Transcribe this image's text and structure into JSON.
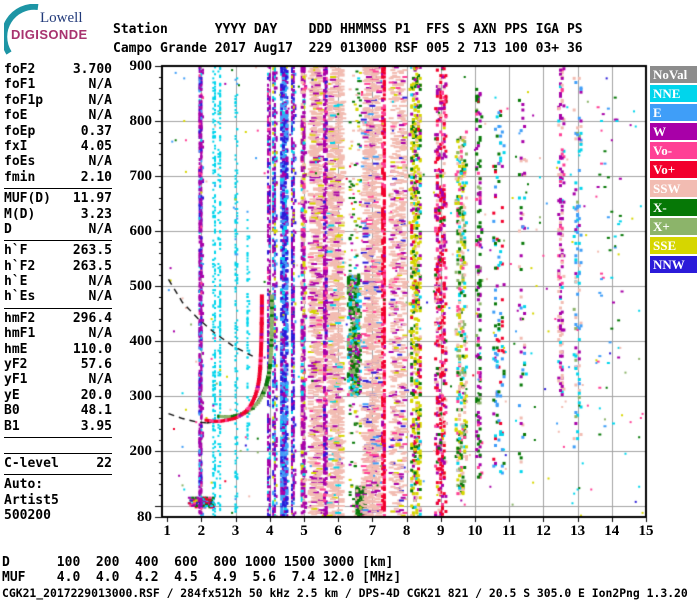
{
  "logo": {
    "line1": "Lowell",
    "line2": "DIGISONDE",
    "arc_color": "#1d95a5"
  },
  "header": {
    "line1": "Station      YYYY DAY    DDD HHMMSS P1  FFS S AXN PPS IGA PS",
    "line2": "Campo Grande 2017 Aug17  229 013000 RSF 005 2 713 100 03+ 36"
  },
  "params": [
    {
      "l": "foF2",
      "v": "3.700"
    },
    {
      "l": "foF1",
      "v": "N/A"
    },
    {
      "l": "foF1p",
      "v": "N/A"
    },
    {
      "l": "foE",
      "v": "N/A"
    },
    {
      "l": "foEp",
      "v": "0.37"
    },
    {
      "l": "fxI",
      "v": "4.05"
    },
    {
      "l": "foEs",
      "v": "N/A"
    },
    {
      "l": "fmin",
      "v": "2.10"
    },
    {
      "t": "sep"
    },
    {
      "l": "MUF(D)",
      "v": "11.97"
    },
    {
      "l": "M(D)",
      "v": "3.23"
    },
    {
      "l": "D",
      "v": "N/A"
    },
    {
      "t": "sep"
    },
    {
      "l": "h`F",
      "v": "263.5"
    },
    {
      "l": "h`F2",
      "v": "263.5"
    },
    {
      "l": "h`E",
      "v": "N/A"
    },
    {
      "l": "h`Es",
      "v": "N/A"
    },
    {
      "t": "sep"
    },
    {
      "l": "hmF2",
      "v": "296.4"
    },
    {
      "l": "hmF1",
      "v": "N/A"
    },
    {
      "l": "hmE",
      "v": "110.0"
    },
    {
      "l": "yF2",
      "v": "57.6"
    },
    {
      "l": "yF1",
      "v": "N/A"
    },
    {
      "l": "yE",
      "v": "20.0"
    },
    {
      "l": "B0",
      "v": "48.1"
    },
    {
      "l": "B1",
      "v": "3.95"
    },
    {
      "t": "sep"
    },
    {
      "t": "gap"
    },
    {
      "t": "sep"
    },
    {
      "l": "C-level",
      "v": "22"
    },
    {
      "t": "sep"
    },
    {
      "l": "Auto:",
      "v": ""
    },
    {
      "l": "Artist5",
      "v": ""
    },
    {
      "l": "500200",
      "v": ""
    }
  ],
  "legend": [
    {
      "label": "NoVal",
      "color": "#8c8c8c"
    },
    {
      "label": "NNE",
      "color": "#00d5ec"
    },
    {
      "label": "E",
      "color": "#3f9ef8"
    },
    {
      "label": "W",
      "color": "#a800a8"
    },
    {
      "label": "Vo-",
      "color": "#ff4095"
    },
    {
      "label": "Vo+",
      "color": "#f2002d"
    },
    {
      "label": "SSW",
      "color": "#f2bcb2"
    },
    {
      "label": "X-",
      "color": "#067806"
    },
    {
      "label": "X+",
      "color": "#8cb46a"
    },
    {
      "label": "SSE",
      "color": "#d6d600"
    },
    {
      "label": "NNW",
      "color": "#2b1bd9"
    }
  ],
  "footer": {
    "d_row": "D      100  200  400  600  800 1000 1500 3000 [km]",
    "muf_row": "MUF    4.0  4.0  4.2  4.5  4.9  5.6  7.4 12.0 [MHz]",
    "status": "CGK21_2017229013000.RSF / 284fx512h 50 kHz 2.5 km / DPS-4D CGK21 821 / 20.5 S 305.0 E Ion2Png 1.3.20"
  },
  "chart_data": {
    "type": "scatter",
    "title": "Digisonde RSF ionogram, Campo Grande, 2017 day 229 01:30:00",
    "xlabel": "[MHz]",
    "ylabel": "[km]",
    "xlim": [
      0.85,
      15.0
    ],
    "ylim": [
      80,
      900
    ],
    "grid": {
      "x_step": 1,
      "y_step": 100,
      "color": "#a2a2a2"
    },
    "x_ticks": [
      1,
      2,
      3,
      4,
      5,
      6,
      7,
      8,
      9,
      10,
      11,
      12,
      13,
      14,
      15
    ],
    "y_tick_labels": [
      900,
      800,
      700,
      600,
      500,
      400,
      300,
      200,
      80
    ],
    "legend_position": "right-outside",
    "palette": {
      "NoVal": "#8c8c8c",
      "NNE": "#00d5ec",
      "E": "#3f9ef8",
      "W": "#a800a8",
      "Vo-": "#ff4095",
      "Vo+": "#f2002d",
      "SSW": "#f2bcb2",
      "X-": "#067806",
      "X+": "#8cb46a",
      "SSE": "#d6d600",
      "NNW": "#2b1bd9"
    },
    "o_trace": {
      "name": "F-layer O-mode echo (foF2 3.70 MHz)",
      "dw": 4,
      "dh": 3,
      "colors": {
        "Vo+": 7,
        "Vo-": 2,
        "W": 1
      },
      "pts": [
        [
          2.15,
          256
        ],
        [
          2.35,
          254
        ],
        [
          2.55,
          254
        ],
        [
          2.75,
          256
        ],
        [
          2.95,
          259
        ],
        [
          3.1,
          263
        ],
        [
          3.25,
          269
        ],
        [
          3.38,
          277
        ],
        [
          3.48,
          287
        ],
        [
          3.57,
          299
        ],
        [
          3.64,
          313
        ],
        [
          3.69,
          330
        ],
        [
          3.72,
          350
        ],
        [
          3.74,
          374
        ],
        [
          3.755,
          402
        ],
        [
          3.765,
          432
        ],
        [
          3.77,
          460
        ],
        [
          3.77,
          482
        ]
      ]
    },
    "x_trace": {
      "name": "F-layer X-mode echo (fxI 4.05 MHz)",
      "dw": 4,
      "dh": 3,
      "colors": {
        "X+": 3,
        "X-": 2
      },
      "pts": [
        [
          2.52,
          263
        ],
        [
          2.72,
          262
        ],
        [
          2.92,
          263
        ],
        [
          3.12,
          266
        ],
        [
          3.32,
          271
        ],
        [
          3.5,
          278
        ],
        [
          3.66,
          288
        ],
        [
          3.79,
          301
        ],
        [
          3.89,
          316
        ],
        [
          3.96,
          334
        ],
        [
          4.01,
          356
        ],
        [
          4.04,
          382
        ],
        [
          4.055,
          412
        ],
        [
          4.06,
          442
        ],
        [
          4.06,
          470
        ],
        [
          4.06,
          482
        ]
      ]
    },
    "curves": [
      {
        "style": "dashed",
        "pts": [
          [
            1.04,
            512
          ],
          [
            1.45,
            470
          ],
          [
            1.9,
            441
          ],
          [
            2.4,
            414
          ],
          [
            2.9,
            392
          ],
          [
            3.35,
            377
          ],
          [
            3.62,
            369
          ]
        ]
      },
      {
        "style": "dashed",
        "pts": [
          [
            1.04,
            268
          ],
          [
            1.45,
            259
          ],
          [
            1.85,
            253
          ],
          [
            2.15,
            251
          ]
        ]
      },
      {
        "style": "solid",
        "pts": [
          [
            2.15,
            251
          ],
          [
            2.6,
            255
          ],
          [
            3.0,
            261
          ],
          [
            3.3,
            269
          ],
          [
            3.55,
            282
          ],
          [
            3.72,
            299
          ],
          [
            3.85,
            317
          ],
          [
            3.93,
            338
          ]
        ]
      },
      {
        "style": "solid",
        "pts": [
          [
            3.52,
            295
          ],
          [
            3.63,
            315
          ],
          [
            3.7,
            340
          ],
          [
            3.73,
            370
          ],
          [
            3.75,
            410
          ],
          [
            3.76,
            450
          ],
          [
            3.76,
            482
          ]
        ]
      }
    ],
    "noise_bands": [
      {
        "f": 2.0,
        "fw": 0.7,
        "h1": 97,
        "h2": 116,
        "n": 150,
        "dw": 3,
        "dh": 2,
        "c": {
          "Vo+": 2,
          "X-": 2,
          "E": 1,
          "W": 1.5,
          "NNE": 1,
          "SSE": 0.6,
          "NNW": 0.6,
          "Vo-": 0.8
        }
      },
      {
        "f": 1.98,
        "fw": 0.1,
        "h1": 80,
        "h2": 900,
        "n": 620,
        "dw": 2,
        "dh": 3,
        "c": {
          "W": 5,
          "NNW": 1,
          "E": 0.8,
          "Vo-": 0.5,
          "NNE": 0.4
        }
      },
      {
        "f": 2.38,
        "fw": 0.07,
        "h1": 80,
        "h2": 900,
        "n": 240,
        "dw": 2,
        "dh": 2,
        "c": {
          "NNE": 1
        }
      },
      {
        "f": 2.54,
        "fw": 0.05,
        "h1": 80,
        "h2": 900,
        "n": 190,
        "dw": 2,
        "dh": 2,
        "c": {
          "NNE": 1
        }
      },
      {
        "f": 3.02,
        "fw": 0.05,
        "h1": 80,
        "h2": 880,
        "n": 170,
        "dw": 2,
        "dh": 2,
        "c": {
          "NNE": 1,
          "E": 0.08
        }
      },
      {
        "f": 3.36,
        "fw": 0.05,
        "h1": 200,
        "h2": 620,
        "n": 80,
        "dw": 2,
        "dh": 2,
        "c": {
          "NNE": 1
        }
      },
      {
        "f": 3.97,
        "fw": 0.09,
        "h1": 80,
        "h2": 900,
        "n": 330,
        "dw": 2,
        "dh": 3,
        "c": {
          "W": 3,
          "NNW": 1,
          "NNE": 0.4,
          "Vo-": 0.4
        }
      },
      {
        "f": 4.14,
        "fw": 0.1,
        "h1": 80,
        "h2": 900,
        "n": 420,
        "dw": 2,
        "dh": 3,
        "c": {
          "W": 3,
          "NNE": 1,
          "NNW": 1,
          "SSE": 0.4,
          "E": 0.6
        }
      },
      {
        "f": 4.42,
        "fw": 0.18,
        "h1": 80,
        "h2": 900,
        "n": 1000,
        "dw": 3,
        "dh": 3,
        "c": {
          "E": 4,
          "NNW": 3,
          "W": 2,
          "NNE": 0.7
        }
      },
      {
        "f": 4.68,
        "fw": 0.1,
        "h1": 80,
        "h2": 900,
        "n": 480,
        "dw": 2,
        "dh": 3,
        "c": {
          "W": 3,
          "NNW": 2,
          "E": 1,
          "NNE": 0.4,
          "SSE": 0.3
        }
      },
      {
        "f": 4.98,
        "fw": 0.1,
        "h1": 80,
        "h2": 900,
        "n": 430,
        "dw": 3,
        "dh": 3,
        "c": {
          "W": 3,
          "SSW": 1,
          "NNE": 0.4,
          "SSE": 0.5,
          "Vo-": 0.5
        }
      },
      {
        "f": 5.38,
        "fw": 0.35,
        "h1": 80,
        "h2": 900,
        "n": 820,
        "dw": 6,
        "dh": 2,
        "c": {
          "SSW": 6,
          "W": 1,
          "Vo-": 0.3,
          "SSE": 0.3
        }
      },
      {
        "f": 5.63,
        "fw": 0.06,
        "h1": 80,
        "h2": 900,
        "n": 380,
        "dw": 3,
        "dh": 3,
        "c": {
          "W": 4,
          "Vo-": 1,
          "NNW": 0.5
        }
      },
      {
        "f": 5.93,
        "fw": 0.4,
        "h1": 80,
        "h2": 900,
        "n": 950,
        "dw": 6,
        "dh": 2,
        "c": {
          "SSW": 8,
          "W": 0.5,
          "SSE": 0.5,
          "NNE": 0.3
        }
      },
      {
        "f": 6.47,
        "fw": 0.35,
        "h1": 300,
        "h2": 520,
        "n": 400,
        "dw": 3,
        "dh": 3,
        "c": {
          "X-": 3,
          "X+": 2,
          "NNE": 1.5,
          "W": 1.5,
          "E": 0.5,
          "Vo-": 0.5,
          "SSE": 0.5
        }
      },
      {
        "f": 6.5,
        "fw": 0.35,
        "h1": 80,
        "h2": 900,
        "n": 170,
        "dw": 3,
        "dh": 2,
        "c": {
          "X-": 2,
          "SSE": 1,
          "W": 1,
          "NNE": 0.5,
          "SSW": 1.5
        }
      },
      {
        "f": 6.68,
        "fw": 0.28,
        "h1": 84,
        "h2": 135,
        "n": 150,
        "dw": 3,
        "dh": 3,
        "c": {
          "X-": 4,
          "X+": 1,
          "W": 1,
          "SSW": 1
        }
      },
      {
        "f": 7.0,
        "fw": 0.5,
        "h1": 80,
        "h2": 900,
        "n": 1050,
        "dw": 6,
        "dh": 2,
        "c": {
          "SSW": 8,
          "Vo-": 0.6,
          "W": 0.5,
          "NNW": 0.3,
          "E": 0.3
        }
      },
      {
        "f": 7.34,
        "fw": 0.07,
        "h1": 80,
        "h2": 900,
        "n": 400,
        "dw": 3,
        "dh": 3,
        "c": {
          "Vo+": 4,
          "Vo-": 1.5,
          "W": 0.5
        }
      },
      {
        "f": 7.76,
        "fw": 0.45,
        "h1": 80,
        "h2": 900,
        "n": 650,
        "dw": 5,
        "dh": 2,
        "c": {
          "SSW": 6,
          "W": 0.8,
          "Vo-": 0.5,
          "NNW": 0.3,
          "SSE": 0.3
        }
      },
      {
        "f": 8.27,
        "fw": 0.3,
        "h1": 80,
        "h2": 900,
        "n": 600,
        "dw": 3,
        "dh": 3,
        "c": {
          "SSE": 4,
          "X-": 1.5,
          "W": 1,
          "SSW": 1,
          "Vo+": 0.5,
          "NNE": 0.3
        }
      },
      {
        "f": 9.0,
        "fw": 0.3,
        "h1": 80,
        "h2": 900,
        "n": 520,
        "dw": 3,
        "dh": 3,
        "c": {
          "Vo+": 3,
          "W": 2,
          "Vo-": 1,
          "SSW": 1,
          "X-": 0.5,
          "SSE": 0.3
        }
      },
      {
        "f": 9.6,
        "fw": 0.28,
        "h1": 120,
        "h2": 780,
        "n": 380,
        "dw": 3,
        "dh": 3,
        "c": {
          "SSW": 2,
          "NNE": 1,
          "SSE": 1.5,
          "X-": 1.5,
          "Vo-": 1,
          "X+": 1
        }
      },
      {
        "f": 10.12,
        "fw": 0.12,
        "h1": 150,
        "h2": 860,
        "n": 150,
        "dw": 3,
        "dh": 3,
        "c": {
          "X-": 2,
          "W": 1.5,
          "X+": 0.5,
          "Vo-": 0.5
        }
      },
      {
        "f": 10.7,
        "fw": 0.3,
        "h1": 150,
        "h2": 820,
        "n": 120,
        "dw": 3,
        "dh": 3,
        "c": {
          "E": 1.5,
          "X-": 1,
          "NNE": 1,
          "Vo+": 1,
          "W": 0.5
        }
      },
      {
        "f": 11.4,
        "fw": 0.2,
        "h1": 150,
        "h2": 850,
        "n": 60,
        "dw": 3,
        "dh": 3,
        "c": {
          "W": 1,
          "X-": 1,
          "SSW": 1,
          "NNE": 0.5,
          "E": 0.5
        }
      },
      {
        "f": 12.52,
        "fw": 0.14,
        "h1": 300,
        "h2": 900,
        "n": 150,
        "dw": 3,
        "dh": 3,
        "c": {
          "W": 2.5,
          "SSW": 1.5,
          "Vo-": 0.5,
          "NNE": 0.3
        }
      },
      {
        "f": 13.0,
        "fw": 0.2,
        "h1": 200,
        "h2": 880,
        "n": 110,
        "dw": 3,
        "dh": 3,
        "c": {
          "E": 1.5,
          "NNE": 1,
          "SSW": 1,
          "W": 0.5,
          "X+": 0.5
        }
      },
      {
        "f": 13.95,
        "fw": 0.7,
        "h1": 200,
        "h2": 860,
        "n": 45,
        "dw": 3,
        "dh": 2,
        "c": {
          "E": 1,
          "NNE": 1,
          "W": 0.5,
          "Vo-": 0.5,
          "X-": 0.5
        }
      },
      {
        "f": 8.0,
        "fw": 13.9,
        "h1": 80,
        "h2": 900,
        "n": 330,
        "dw": 2,
        "dh": 2,
        "c": {
          "NNE": 1,
          "E": 1,
          "W": 1,
          "Vo-": 1,
          "X-": 1,
          "SSE": 1,
          "SSW": 1,
          "NNW": 0.5,
          "Vo+": 0.5,
          "X+": 0.5
        }
      }
    ]
  }
}
